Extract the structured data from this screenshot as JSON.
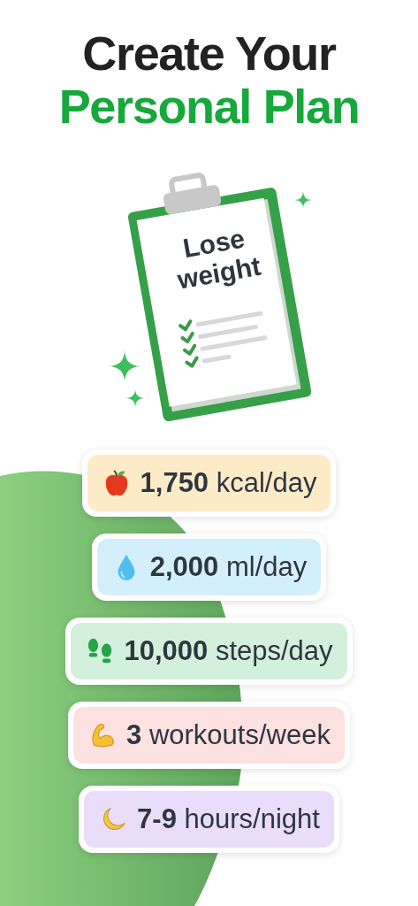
{
  "title": {
    "line_1": "Create Your",
    "line_2": "Personal Plan"
  },
  "clipboard": {
    "heading": "Lose weight"
  },
  "goals": [
    {
      "kind": "apple",
      "value": "1,750",
      "unit": "kcal/day",
      "color": "#fdebc8"
    },
    {
      "kind": "drop",
      "value": "2,000",
      "unit": "ml/day",
      "color": "#d4effc"
    },
    {
      "kind": "footprints",
      "value": "10,000",
      "unit": "steps/day",
      "color": "#d3f0dc"
    },
    {
      "kind": "muscle",
      "value": "3",
      "unit": "workouts/week",
      "color": "#fde0e0"
    },
    {
      "kind": "moon",
      "value": "7-9",
      "unit": "hours/night",
      "color": "#eadcfb"
    }
  ]
}
